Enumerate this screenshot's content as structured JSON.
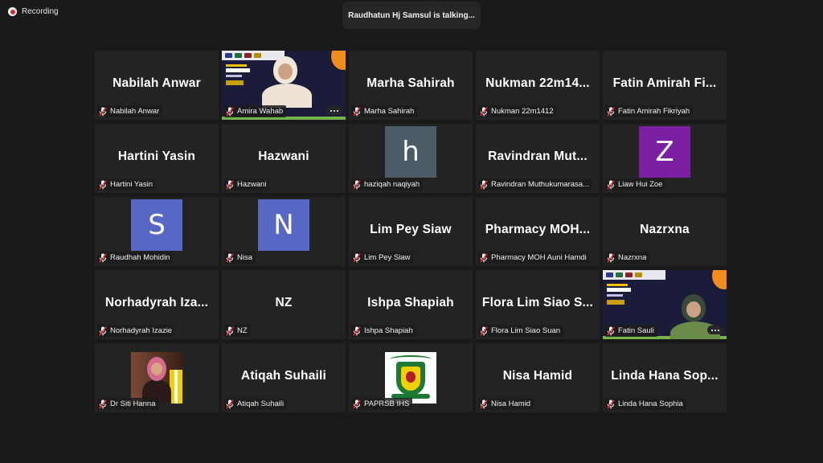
{
  "recording": {
    "label": "Recording"
  },
  "talking_banner": {
    "text": "Raudhatun Hj Samsul is talking..."
  },
  "tiles": [
    {
      "type": "name",
      "display": "Nabilah Anwar",
      "label": "Nabilah Anwar"
    },
    {
      "type": "video",
      "display": "",
      "label": "Amira Wahab"
    },
    {
      "type": "name",
      "display": "Marha Sahirah",
      "label": "Marha Sahirah"
    },
    {
      "type": "name",
      "display": "Nukman 22m14...",
      "label": "Nukman 22m1412"
    },
    {
      "type": "name",
      "display": "Fatin Amirah Fi...",
      "label": "Fatin Amirah Fikriyah"
    },
    {
      "type": "name",
      "display": "Hartini Yasin",
      "label": "Hartini Yasin"
    },
    {
      "type": "name",
      "display": "Hazwani",
      "label": "Hazwani"
    },
    {
      "type": "avatar",
      "display": "h",
      "color": "#4c5c66",
      "label": "haziqah naqiyah"
    },
    {
      "type": "name",
      "display": "Ravindran Mut...",
      "label": "Ravindran Muthukumarasa..."
    },
    {
      "type": "avatar",
      "display": "Z",
      "color": "#7b1fa2",
      "label": "Liaw Hui Zoe"
    },
    {
      "type": "avatar",
      "display": "S",
      "color": "#5867c4",
      "label": "Raudhah Mohidin"
    },
    {
      "type": "avatar",
      "display": "N",
      "color": "#5867c4",
      "label": "Nisa"
    },
    {
      "type": "name",
      "display": "Lim Pey Siaw",
      "label": "Lim Pey Siaw"
    },
    {
      "type": "name",
      "display": "Pharmacy MOH...",
      "label": "Pharmacy MOH Auni Hamdi"
    },
    {
      "type": "name",
      "display": "Nazrxna",
      "label": "Nazrxna"
    },
    {
      "type": "name",
      "display": "Norhadyrah Iza...",
      "label": "Norhadyrah Izazie"
    },
    {
      "type": "name",
      "display": "NZ",
      "label": "NZ"
    },
    {
      "type": "name",
      "display": "Ishpa Shapiah",
      "label": "Ishpa Shapiah"
    },
    {
      "type": "name",
      "display": "Flora Lim Siao S...",
      "label": "Flora Lim Siao Suan"
    },
    {
      "type": "video2",
      "display": "",
      "label": "Fatin Sauli"
    },
    {
      "type": "photo",
      "display": "",
      "label": "Dr Siti Hanna"
    },
    {
      "type": "name",
      "display": "Atiqah Suhaili",
      "label": "Atiqah Suhaili"
    },
    {
      "type": "logo",
      "display": "",
      "label": "PAPRSB IHS"
    },
    {
      "type": "name",
      "display": "Nisa Hamid",
      "label": "Nisa Hamid"
    },
    {
      "type": "name",
      "display": "Linda Hana Sop...",
      "label": "Linda Hana Sophia"
    }
  ],
  "colors": {
    "background": "#1a1a1a",
    "tile": "#232323",
    "muted_mic": "#e0272c"
  },
  "icons": {
    "muted": "mic-muted-icon",
    "more": "more-options-icon",
    "record": "record-dot-icon"
  }
}
